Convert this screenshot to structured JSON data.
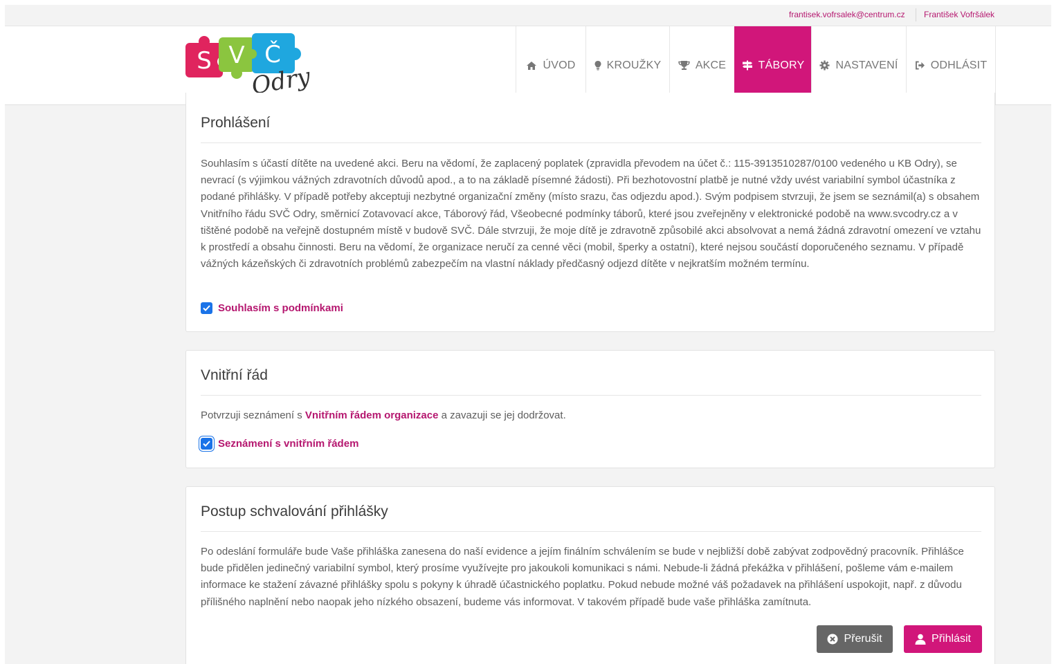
{
  "topbar": {
    "email": "frantisek.vofrsalek@centrum.cz",
    "user_name": "František Vofršálek"
  },
  "logo": {
    "letters": [
      "S",
      "V",
      "Č"
    ],
    "script_text": "Odry"
  },
  "nav": {
    "items": [
      {
        "label": "ÚVOD",
        "icon": "home-icon"
      },
      {
        "label": "KROUŽKY",
        "icon": "lightbulb-icon"
      },
      {
        "label": "AKCE",
        "icon": "trophy-icon"
      },
      {
        "label": "TÁBORY",
        "icon": "signpost-icon",
        "active": true
      },
      {
        "label": "NASTAVENÍ",
        "icon": "gear-icon"
      },
      {
        "label": "ODHLÁSIT",
        "icon": "sign-out-icon"
      }
    ]
  },
  "declaration": {
    "title": "Prohlášení",
    "text": "Souhlasím s účastí dítěte na uvedené akci. Beru na vědomí, že zaplacený poplatek (zpravidla převodem na účet č.: 115-3913510287/0100 vedeného u KB Odry), se nevrací (s výjimkou vážných zdravotních důvodů apod., a to na základě písemné žádosti). Při bezhotovostní platbě je nutné vždy uvést variabilní symbol účastníka z podané přihlášky. V případě potřeby akceptuji nezbytné organizační změny (místo srazu, čas odjezdu apod.). Svým podpisem stvrzuji, že jsem se seznámil(a) s obsahem Vnitřního řádu SVČ Odry, směrnicí Zotavovací akce, Táborový řád, Všeobecné podmínky táborů, které jsou zveřejněny v elektronické podobě na www.svcodry.cz a v tištěné podobě na veřejně dostupném místě v budově SVČ. Dále stvrzuji, že moje dítě je zdravotně způsobilé akci absolvovat a nemá žádná zdravotní omezení ve vztahu k prostředí a obsahu činnosti. Beru na vědomí, že organizace neručí za cenné věci (mobil, šperky a ostatní), které nejsou součástí doporučeného seznamu. V případě vážných kázeňských či zdravotních problémů zabezpečím na vlastní náklady předčasný odjezd dítěte v nejkratším možném termínu.",
    "checkbox_label": "Souhlasím s podmínkami",
    "checked": true
  },
  "internal_rules": {
    "title": "Vnitřní řád",
    "text_before": "Potvrzuji seznámení s ",
    "link_text": "Vnitřním řádem organizace",
    "text_after": " a zavazuji se jej dodržovat.",
    "checkbox_label": "Seznámení s vnitřním řádem",
    "checked": true
  },
  "approval": {
    "title": "Postup schvalování přihlášky",
    "text": "Po odeslání formuláře bude Vaše přihláška zanesena do naší evidence a jejím finálním schválením se bude v nejbližší době zabývat zodpovědný pracovník. Přihlášce bude přidělen jedinečný variabilní symbol, který prosíme využívejte pro jakoukoli komunikaci s námi. Nebude-li žádná překážka v přihlášení, pošleme vám e-mailem informace ke stažení závazné přihlášky spolu s pokyny k úhradě účastnického poplatku. Pokud nebude možné váš požadavek na přihlášení uspokojit, např. z důvodu přílišného naplnění nebo naopak jeho nízkého obsazení, budeme vás informovat. V takovém případě bude vaše přihláška zamítnuta.",
    "cancel_label": "Přerušit",
    "submit_label": "Přihlásit"
  },
  "colors": {
    "accent": "#d1167a",
    "link": "#b5176f",
    "checkbox": "#1a73e8",
    "cancel_button": "#666666"
  }
}
